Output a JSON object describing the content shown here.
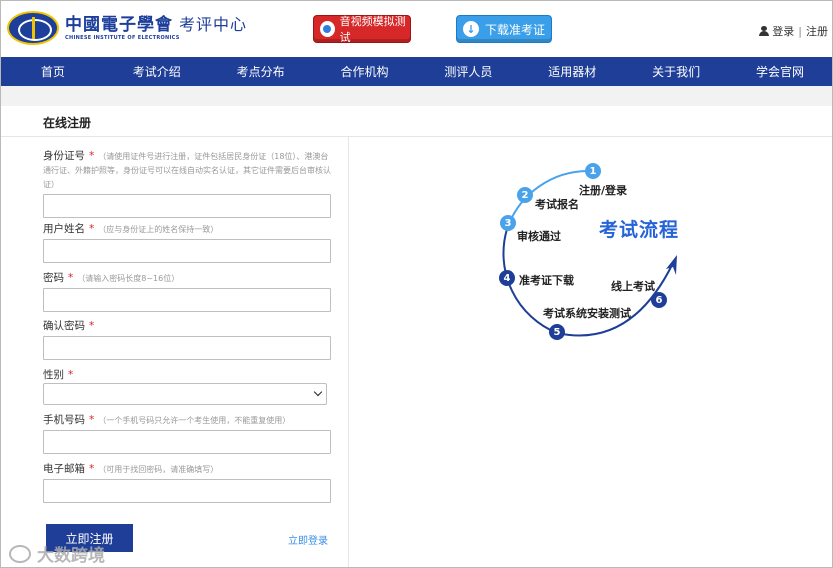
{
  "header": {
    "logo_cn": "中國電子學會",
    "logo_sub": "考评中心",
    "logo_en": "CHINESE INSTITUTE OF ELECTRONICS",
    "av_test_label": "音视频模拟测试",
    "download_ticket_label": "下载准考证",
    "login_label": "登录",
    "separator": "|",
    "register_label": "注册"
  },
  "nav": {
    "items": [
      "首页",
      "考试介绍",
      "考点分布",
      "合作机构",
      "测评人员",
      "适用器材",
      "关于我们",
      "学会官网"
    ]
  },
  "page": {
    "section_title": "在线注册"
  },
  "form": {
    "required_mark": "*",
    "id_number": {
      "label": "身份证号",
      "hint": "（请使用证件号进行注册，证件包括居民身份证（18位）、港澳台通行证、外籍护照等，身份证号可以在线自动实名认证，其它证件需要后台审核认证）"
    },
    "username": {
      "label": "用户姓名",
      "hint": "（应与身份证上的姓名保持一致）"
    },
    "password": {
      "label": "密码",
      "hint": "（请输入密码长度8~16位）"
    },
    "confirm_password": {
      "label": "确认密码"
    },
    "gender": {
      "label": "性别",
      "selected": ""
    },
    "phone": {
      "label": "手机号码",
      "hint": "（一个手机号码只允许一个考生使用，不能重复使用）"
    },
    "email": {
      "label": "电子邮箱",
      "hint": "（可用于找回密码，请准确填写）"
    },
    "submit_label": "立即注册",
    "login_link": "立即登录"
  },
  "diagram": {
    "title": "考试流程",
    "steps": [
      {
        "num": "1",
        "label": "注册/登录"
      },
      {
        "num": "2",
        "label": "考试报名"
      },
      {
        "num": "3",
        "label": "审核通过"
      },
      {
        "num": "4",
        "label": "准考证下载"
      },
      {
        "num": "5",
        "label": "考试系统安装测试"
      },
      {
        "num": "6",
        "label": "线上考试"
      }
    ],
    "colors": {
      "light": "#4aa3ea",
      "dark": "#1f3e97",
      "title": "#2563d8"
    }
  },
  "watermark": {
    "text": "大数跨境"
  }
}
